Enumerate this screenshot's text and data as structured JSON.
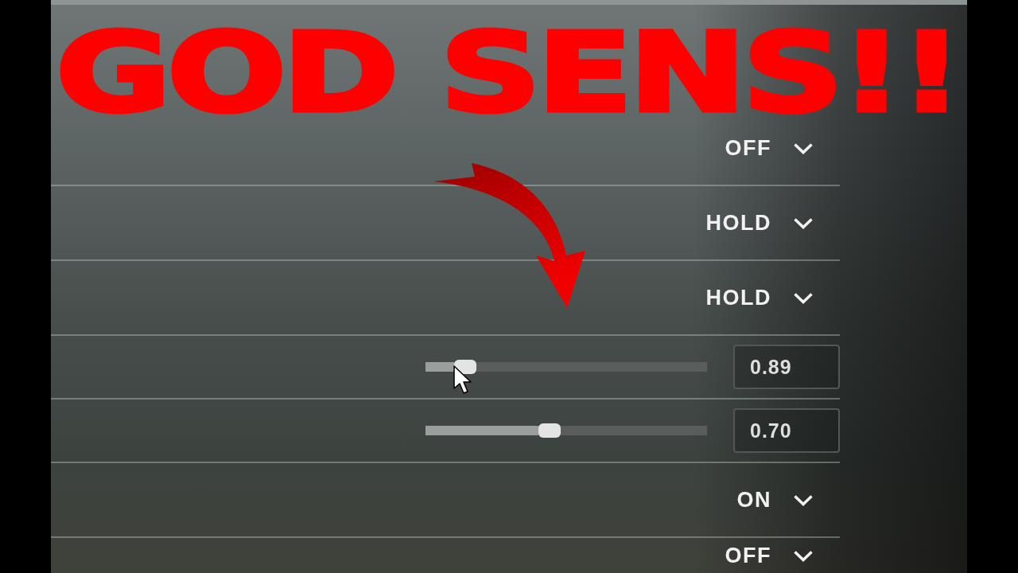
{
  "title": "GOD SENS!!",
  "settings": [
    {
      "kind": "dropdown",
      "value": "OFF"
    },
    {
      "kind": "dropdown",
      "value": "HOLD"
    },
    {
      "kind": "dropdown",
      "value": "HOLD"
    },
    {
      "kind": "slider",
      "level": 0.14,
      "value": "0.89"
    },
    {
      "kind": "slider",
      "level": 0.44,
      "value": "0.70"
    },
    {
      "kind": "dropdown",
      "value": "ON"
    },
    {
      "kind": "dropdown",
      "value": "OFF"
    }
  ]
}
